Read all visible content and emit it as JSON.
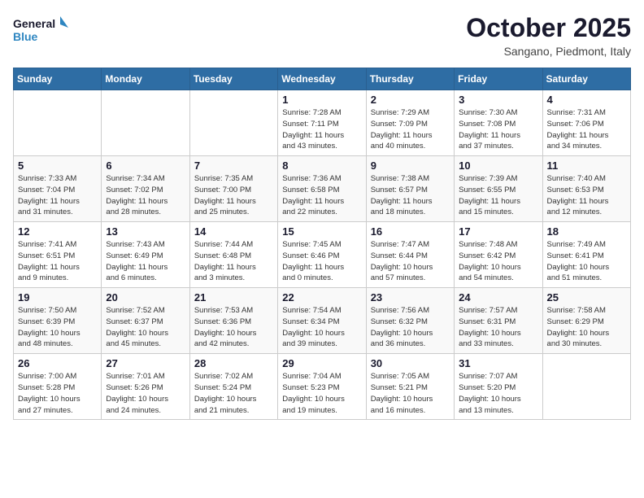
{
  "header": {
    "logo_line1": "General",
    "logo_line2": "Blue",
    "month": "October 2025",
    "location": "Sangano, Piedmont, Italy"
  },
  "weekdays": [
    "Sunday",
    "Monday",
    "Tuesday",
    "Wednesday",
    "Thursday",
    "Friday",
    "Saturday"
  ],
  "weeks": [
    [
      {
        "day": "",
        "info": ""
      },
      {
        "day": "",
        "info": ""
      },
      {
        "day": "",
        "info": ""
      },
      {
        "day": "1",
        "info": "Sunrise: 7:28 AM\nSunset: 7:11 PM\nDaylight: 11 hours\nand 43 minutes."
      },
      {
        "day": "2",
        "info": "Sunrise: 7:29 AM\nSunset: 7:09 PM\nDaylight: 11 hours\nand 40 minutes."
      },
      {
        "day": "3",
        "info": "Sunrise: 7:30 AM\nSunset: 7:08 PM\nDaylight: 11 hours\nand 37 minutes."
      },
      {
        "day": "4",
        "info": "Sunrise: 7:31 AM\nSunset: 7:06 PM\nDaylight: 11 hours\nand 34 minutes."
      }
    ],
    [
      {
        "day": "5",
        "info": "Sunrise: 7:33 AM\nSunset: 7:04 PM\nDaylight: 11 hours\nand 31 minutes."
      },
      {
        "day": "6",
        "info": "Sunrise: 7:34 AM\nSunset: 7:02 PM\nDaylight: 11 hours\nand 28 minutes."
      },
      {
        "day": "7",
        "info": "Sunrise: 7:35 AM\nSunset: 7:00 PM\nDaylight: 11 hours\nand 25 minutes."
      },
      {
        "day": "8",
        "info": "Sunrise: 7:36 AM\nSunset: 6:58 PM\nDaylight: 11 hours\nand 22 minutes."
      },
      {
        "day": "9",
        "info": "Sunrise: 7:38 AM\nSunset: 6:57 PM\nDaylight: 11 hours\nand 18 minutes."
      },
      {
        "day": "10",
        "info": "Sunrise: 7:39 AM\nSunset: 6:55 PM\nDaylight: 11 hours\nand 15 minutes."
      },
      {
        "day": "11",
        "info": "Sunrise: 7:40 AM\nSunset: 6:53 PM\nDaylight: 11 hours\nand 12 minutes."
      }
    ],
    [
      {
        "day": "12",
        "info": "Sunrise: 7:41 AM\nSunset: 6:51 PM\nDaylight: 11 hours\nand 9 minutes."
      },
      {
        "day": "13",
        "info": "Sunrise: 7:43 AM\nSunset: 6:49 PM\nDaylight: 11 hours\nand 6 minutes."
      },
      {
        "day": "14",
        "info": "Sunrise: 7:44 AM\nSunset: 6:48 PM\nDaylight: 11 hours\nand 3 minutes."
      },
      {
        "day": "15",
        "info": "Sunrise: 7:45 AM\nSunset: 6:46 PM\nDaylight: 11 hours\nand 0 minutes."
      },
      {
        "day": "16",
        "info": "Sunrise: 7:47 AM\nSunset: 6:44 PM\nDaylight: 10 hours\nand 57 minutes."
      },
      {
        "day": "17",
        "info": "Sunrise: 7:48 AM\nSunset: 6:42 PM\nDaylight: 10 hours\nand 54 minutes."
      },
      {
        "day": "18",
        "info": "Sunrise: 7:49 AM\nSunset: 6:41 PM\nDaylight: 10 hours\nand 51 minutes."
      }
    ],
    [
      {
        "day": "19",
        "info": "Sunrise: 7:50 AM\nSunset: 6:39 PM\nDaylight: 10 hours\nand 48 minutes."
      },
      {
        "day": "20",
        "info": "Sunrise: 7:52 AM\nSunset: 6:37 PM\nDaylight: 10 hours\nand 45 minutes."
      },
      {
        "day": "21",
        "info": "Sunrise: 7:53 AM\nSunset: 6:36 PM\nDaylight: 10 hours\nand 42 minutes."
      },
      {
        "day": "22",
        "info": "Sunrise: 7:54 AM\nSunset: 6:34 PM\nDaylight: 10 hours\nand 39 minutes."
      },
      {
        "day": "23",
        "info": "Sunrise: 7:56 AM\nSunset: 6:32 PM\nDaylight: 10 hours\nand 36 minutes."
      },
      {
        "day": "24",
        "info": "Sunrise: 7:57 AM\nSunset: 6:31 PM\nDaylight: 10 hours\nand 33 minutes."
      },
      {
        "day": "25",
        "info": "Sunrise: 7:58 AM\nSunset: 6:29 PM\nDaylight: 10 hours\nand 30 minutes."
      }
    ],
    [
      {
        "day": "26",
        "info": "Sunrise: 7:00 AM\nSunset: 5:28 PM\nDaylight: 10 hours\nand 27 minutes."
      },
      {
        "day": "27",
        "info": "Sunrise: 7:01 AM\nSunset: 5:26 PM\nDaylight: 10 hours\nand 24 minutes."
      },
      {
        "day": "28",
        "info": "Sunrise: 7:02 AM\nSunset: 5:24 PM\nDaylight: 10 hours\nand 21 minutes."
      },
      {
        "day": "29",
        "info": "Sunrise: 7:04 AM\nSunset: 5:23 PM\nDaylight: 10 hours\nand 19 minutes."
      },
      {
        "day": "30",
        "info": "Sunrise: 7:05 AM\nSunset: 5:21 PM\nDaylight: 10 hours\nand 16 minutes."
      },
      {
        "day": "31",
        "info": "Sunrise: 7:07 AM\nSunset: 5:20 PM\nDaylight: 10 hours\nand 13 minutes."
      },
      {
        "day": "",
        "info": ""
      }
    ]
  ]
}
